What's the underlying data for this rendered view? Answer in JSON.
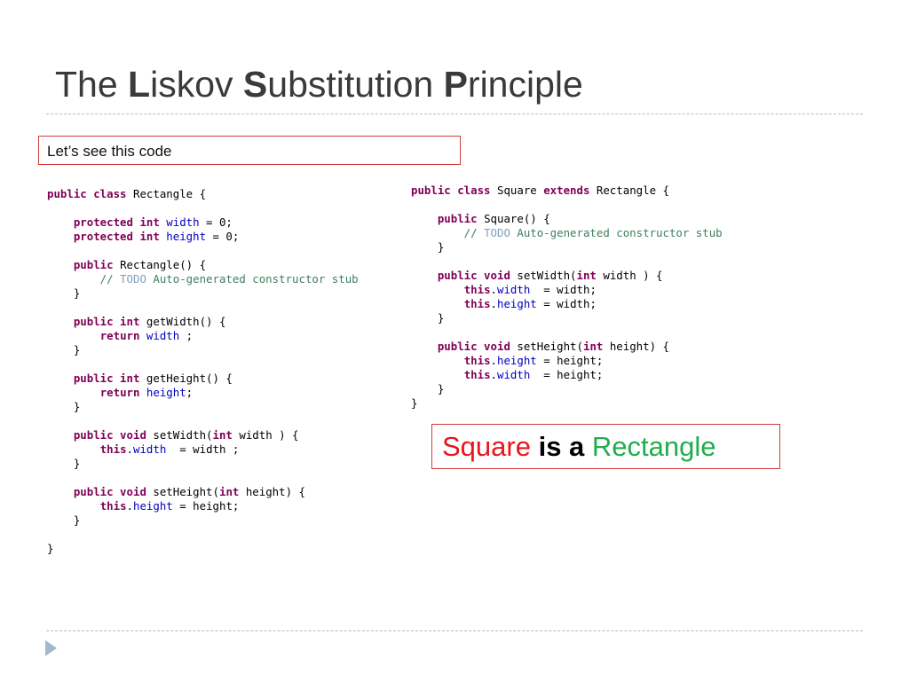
{
  "title": {
    "p1": "The ",
    "b1": "L",
    "p2": "iskov ",
    "b2": "S",
    "p3": "ubstitution ",
    "b3": "P",
    "p4": "rinciple"
  },
  "note": "Let’s see this code",
  "callout": {
    "w1": "Square",
    "w2": " is a ",
    "w3": "Rectangle",
    "colors": {
      "square": "#e8141c",
      "is_a": "#000000",
      "rectangle": "#1fae4b"
    }
  },
  "syntax_colors": {
    "keyword": "#7f0055",
    "field": "#0000c0",
    "comment": "#3f7f5f",
    "todo": "#7f9fbf"
  },
  "code_left": [
    [
      [
        "k",
        "public class "
      ],
      [
        "p",
        "Rectangle {"
      ]
    ],
    [],
    [
      [
        "p",
        "    "
      ],
      [
        "k",
        "protected int "
      ],
      [
        "f",
        "width"
      ],
      [
        "p",
        " = 0;"
      ]
    ],
    [
      [
        "p",
        "    "
      ],
      [
        "k",
        "protected int "
      ],
      [
        "f",
        "height"
      ],
      [
        "p",
        " = 0;"
      ]
    ],
    [],
    [
      [
        "p",
        "    "
      ],
      [
        "k",
        "public "
      ],
      [
        "p",
        "Rectangle() {"
      ]
    ],
    [
      [
        "c",
        "        // "
      ],
      [
        "t",
        "TODO"
      ],
      [
        "c",
        " Auto-generated constructor stub"
      ]
    ],
    [
      [
        "p",
        "    }"
      ]
    ],
    [],
    [
      [
        "p",
        "    "
      ],
      [
        "k",
        "public int "
      ],
      [
        "p",
        "getWidth() {"
      ]
    ],
    [
      [
        "p",
        "        "
      ],
      [
        "k",
        "return "
      ],
      [
        "f",
        "width"
      ],
      [
        "p",
        " ;"
      ]
    ],
    [
      [
        "p",
        "    }"
      ]
    ],
    [],
    [
      [
        "p",
        "    "
      ],
      [
        "k",
        "public int "
      ],
      [
        "p",
        "getHeight() {"
      ]
    ],
    [
      [
        "p",
        "        "
      ],
      [
        "k",
        "return "
      ],
      [
        "f",
        "height"
      ],
      [
        "p",
        ";"
      ]
    ],
    [
      [
        "p",
        "    }"
      ]
    ],
    [],
    [
      [
        "p",
        "    "
      ],
      [
        "k",
        "public void "
      ],
      [
        "p",
        "setWidth("
      ],
      [
        "k",
        "int "
      ],
      [
        "p",
        "width ) {"
      ]
    ],
    [
      [
        "p",
        "        "
      ],
      [
        "k",
        "this"
      ],
      [
        "p",
        "."
      ],
      [
        "f",
        "width"
      ],
      [
        "p",
        "  = width ;"
      ]
    ],
    [
      [
        "p",
        "    }"
      ]
    ],
    [],
    [
      [
        "p",
        "    "
      ],
      [
        "k",
        "public void "
      ],
      [
        "p",
        "setHeight("
      ],
      [
        "k",
        "int "
      ],
      [
        "p",
        "height) {"
      ]
    ],
    [
      [
        "p",
        "        "
      ],
      [
        "k",
        "this"
      ],
      [
        "p",
        "."
      ],
      [
        "f",
        "height"
      ],
      [
        "p",
        " = height;"
      ]
    ],
    [
      [
        "p",
        "    }"
      ]
    ],
    [],
    [
      [
        "p",
        "}"
      ]
    ]
  ],
  "code_right": [
    [
      [
        "k",
        "public class "
      ],
      [
        "p",
        "Square "
      ],
      [
        "k",
        "extends "
      ],
      [
        "p",
        "Rectangle {"
      ]
    ],
    [],
    [
      [
        "p",
        "    "
      ],
      [
        "k",
        "public "
      ],
      [
        "p",
        "Square() {"
      ]
    ],
    [
      [
        "c",
        "        // "
      ],
      [
        "t",
        "TODO"
      ],
      [
        "c",
        " Auto-generated constructor stub"
      ]
    ],
    [
      [
        "p",
        "    }"
      ]
    ],
    [],
    [
      [
        "p",
        "    "
      ],
      [
        "k",
        "public void "
      ],
      [
        "p",
        "setWidth("
      ],
      [
        "k",
        "int "
      ],
      [
        "p",
        "width ) {"
      ]
    ],
    [
      [
        "p",
        "        "
      ],
      [
        "k",
        "this"
      ],
      [
        "p",
        "."
      ],
      [
        "f",
        "width"
      ],
      [
        "p",
        "  = width;"
      ]
    ],
    [
      [
        "p",
        "        "
      ],
      [
        "k",
        "this"
      ],
      [
        "p",
        "."
      ],
      [
        "f",
        "height"
      ],
      [
        "p",
        " = width;"
      ]
    ],
    [
      [
        "p",
        "    }"
      ]
    ],
    [],
    [
      [
        "p",
        "    "
      ],
      [
        "k",
        "public void "
      ],
      [
        "p",
        "setHeight("
      ],
      [
        "k",
        "int "
      ],
      [
        "p",
        "height) {"
      ]
    ],
    [
      [
        "p",
        "        "
      ],
      [
        "k",
        "this"
      ],
      [
        "p",
        "."
      ],
      [
        "f",
        "height"
      ],
      [
        "p",
        " = height;"
      ]
    ],
    [
      [
        "p",
        "        "
      ],
      [
        "k",
        "this"
      ],
      [
        "p",
        "."
      ],
      [
        "f",
        "width"
      ],
      [
        "p",
        "  = height;"
      ]
    ],
    [
      [
        "p",
        "    }"
      ]
    ],
    [
      [
        "p",
        "}"
      ]
    ]
  ]
}
